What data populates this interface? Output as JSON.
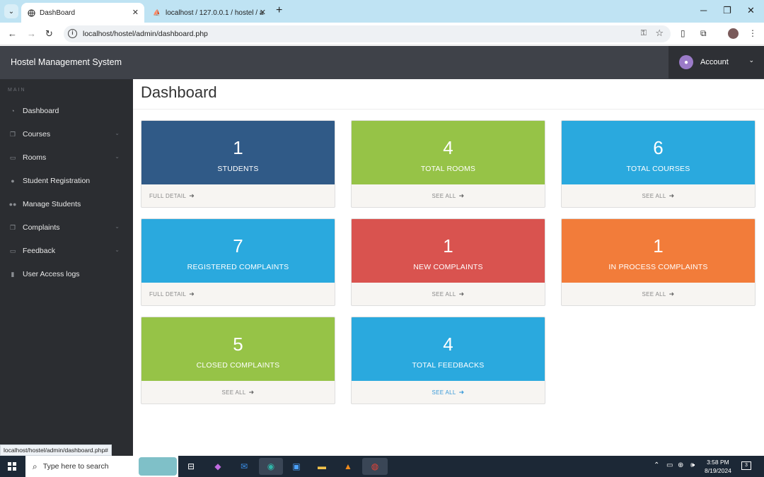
{
  "browser": {
    "tabs": [
      {
        "title": "DashBoard",
        "active": true
      },
      {
        "title": "localhost / 127.0.0.1 / hostel / a",
        "active": false
      }
    ],
    "url": "localhost/hostel/admin/dashboard.php",
    "status_url": "localhost/hostel/admin/dashboard.php#"
  },
  "header": {
    "brand": "Hostel Management System",
    "account_label": "Account"
  },
  "sidebar": {
    "section": "MAIN",
    "items": [
      {
        "label": "Dashboard",
        "icon": "dashboard-icon",
        "has_caret": false
      },
      {
        "label": "Courses",
        "icon": "files-icon",
        "has_caret": true
      },
      {
        "label": "Rooms",
        "icon": "desktop-icon",
        "has_caret": true
      },
      {
        "label": "Student Registration",
        "icon": "user-icon",
        "has_caret": false
      },
      {
        "label": "Manage Students",
        "icon": "users-icon",
        "has_caret": false
      },
      {
        "label": "Complaints",
        "icon": "files-icon",
        "has_caret": true
      },
      {
        "label": "Feedback",
        "icon": "desktop-icon",
        "has_caret": true
      },
      {
        "label": "User Access logs",
        "icon": "file-icon",
        "has_caret": false
      }
    ]
  },
  "main": {
    "title": "Dashboard",
    "cards": [
      {
        "value": "1",
        "label": "STUDENTS",
        "link": "FULL DETAIL",
        "color": "#305a87",
        "align": "left",
        "blue": false
      },
      {
        "value": "4",
        "label": "TOTAL ROOMS",
        "link": "SEE ALL",
        "color": "#96c347",
        "align": "center",
        "blue": false
      },
      {
        "value": "6",
        "label": "TOTAL COURSES",
        "link": "SEE ALL",
        "color": "#2aa9de",
        "align": "center",
        "blue": false
      },
      {
        "value": "7",
        "label": "REGISTERED COMPLAINTS",
        "link": "FULL DETAIL",
        "color": "#2aa9de",
        "align": "left",
        "blue": false
      },
      {
        "value": "1",
        "label": "NEW COMPLAINTS",
        "link": "SEE ALL",
        "color": "#d9534f",
        "align": "center",
        "blue": false
      },
      {
        "value": "1",
        "label": "IN PROCESS COMPLAINTS",
        "link": "SEE ALL",
        "color": "#f27c3a",
        "align": "center",
        "blue": false
      },
      {
        "value": "5",
        "label": "CLOSED COMPLAINTS",
        "link": "SEE ALL",
        "color": "#96c347",
        "align": "center",
        "blue": false
      },
      {
        "value": "4",
        "label": "TOTAL FEEDBACKS",
        "link": "SEE ALL",
        "color": "#2aa9de",
        "align": "center",
        "blue": true
      }
    ]
  },
  "taskbar": {
    "search_placeholder": "Type here to search",
    "time": "3:58 PM",
    "date": "8/19/2024",
    "notifications": "3"
  }
}
